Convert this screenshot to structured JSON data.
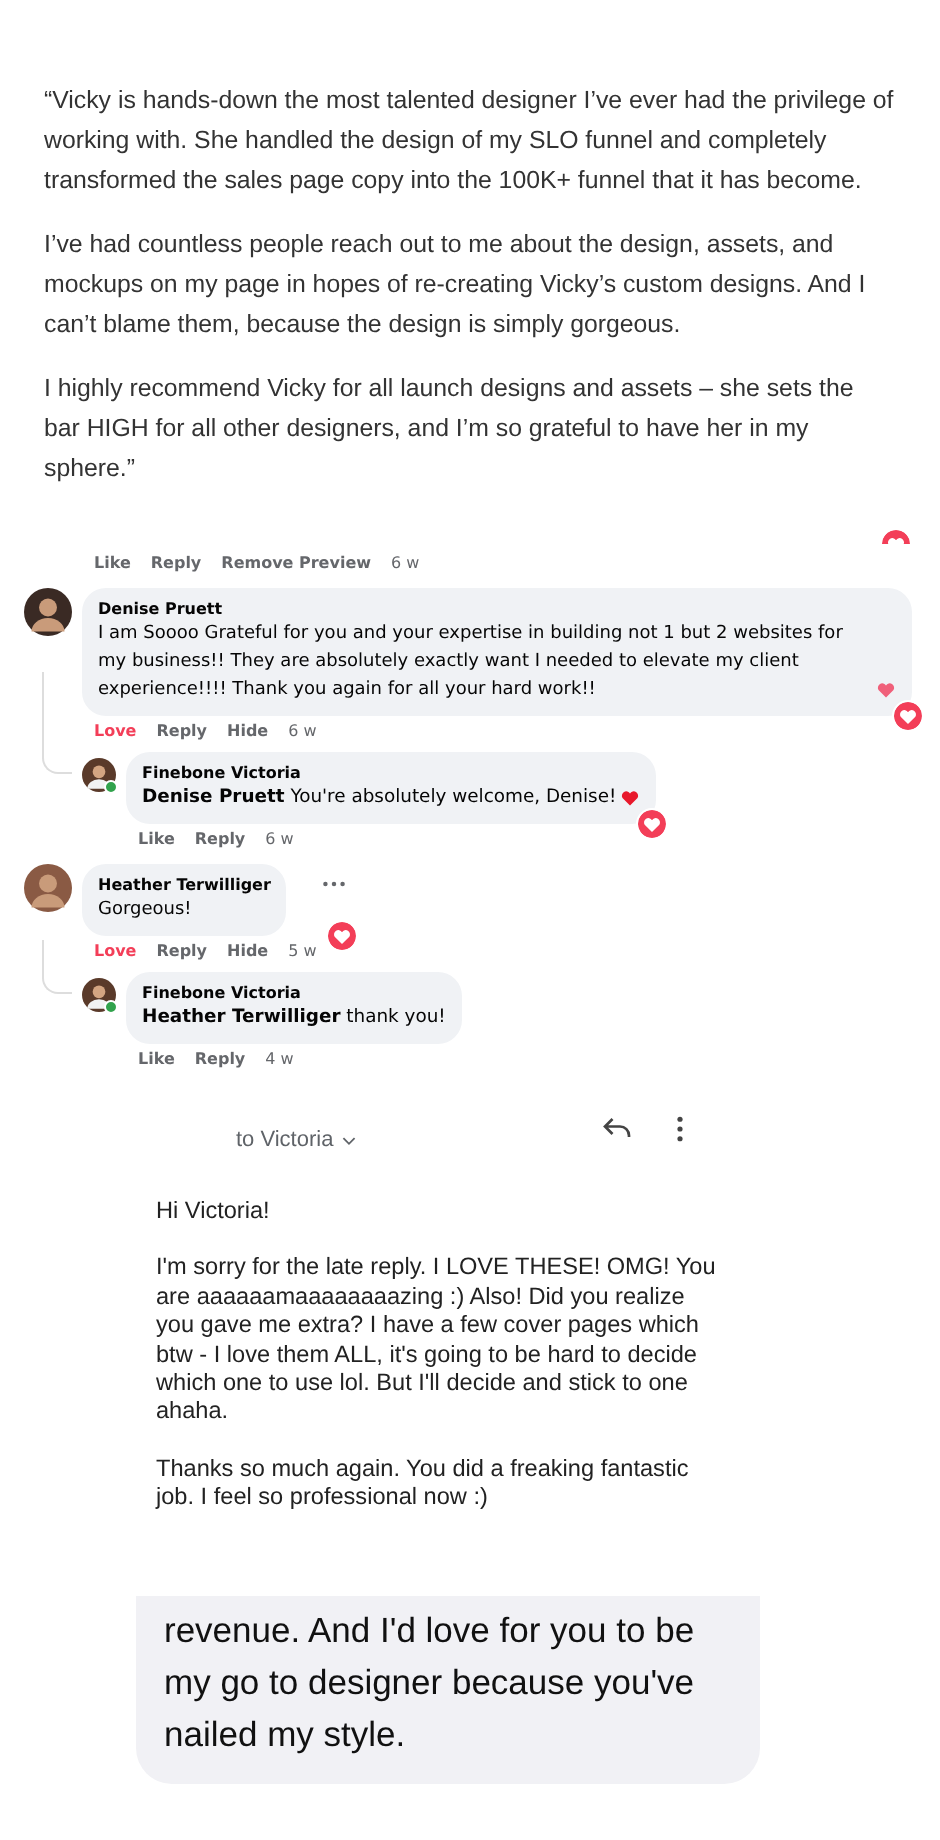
{
  "testimonial": {
    "paragraphs": [
      "“Vicky is hands-down the most talented designer I’ve ever had the privilege of working with. She handled the design of my SLO funnel and completely transformed the sales page copy into the 100K+ funnel that it has become.",
      "I’ve had countless people reach out to me about the design, assets, and mockups on my page in hopes of re-creating Vicky’s custom designs. And I can’t blame them, because the design is simply gorgeous.",
      "I highly recommend Vicky for all launch designs and assets – she sets the bar HIGH for all other designers, and I’m so grateful to have her in my sphere.”"
    ]
  },
  "comments": {
    "top_actions": {
      "reacted": false,
      "labels": [
        "Like",
        "Reply",
        "Remove Preview"
      ],
      "time": "6 w"
    },
    "threads": [
      {
        "author": "Denise Pruett",
        "text": "I am Soooo Grateful for you and your expertise in building not 1 but 2 websites for my business!! They are absolutely exactly want I needed to elevate my client experience!!!! Thank you again for all your hard work!!",
        "emoji_heart": true,
        "reacted": true,
        "labels": [
          "Love",
          "Reply",
          "Hide"
        ],
        "time": "6 w",
        "more": false,
        "replies": [
          {
            "author": "Finebone Victoria",
            "text": "**Denise Pruett** You're absolutely welcome, Denise!",
            "emoji_heart": true,
            "reacted": false,
            "labels": [
              "Like",
              "Reply"
            ],
            "time": "6 w"
          }
        ]
      },
      {
        "author": "Heather Terwilliger",
        "text": "Gorgeous!",
        "emoji_heart": false,
        "reacted": true,
        "labels": [
          "Love",
          "Reply",
          "Hide"
        ],
        "time": "5 w",
        "more": true,
        "replies": [
          {
            "author": "Finebone Victoria",
            "text": "**Heather Terwilliger** thank you!",
            "emoji_heart": false,
            "reacted": false,
            "labels": [
              "Like",
              "Reply"
            ],
            "time": "4 w"
          }
        ]
      }
    ]
  },
  "email": {
    "recipient": "to Victoria",
    "paragraphs": [
      "Hi Victoria!",
      "I'm sorry for the late reply. I LOVE THESE! OMG! You are aaaaaamaaaaaaaazing :) Also! Did you realize you gave me extra? I have a few cover pages which btw - I love them ALL, it's going to be hard to decide which one to use lol. But I'll decide and stick to one ahaha.",
      "Thanks so much again. You did a freaking fantastic job. I feel so professional now :)"
    ]
  },
  "message": {
    "text": "revenue. And I'd love for you to be my go to designer because you've nailed my style."
  }
}
